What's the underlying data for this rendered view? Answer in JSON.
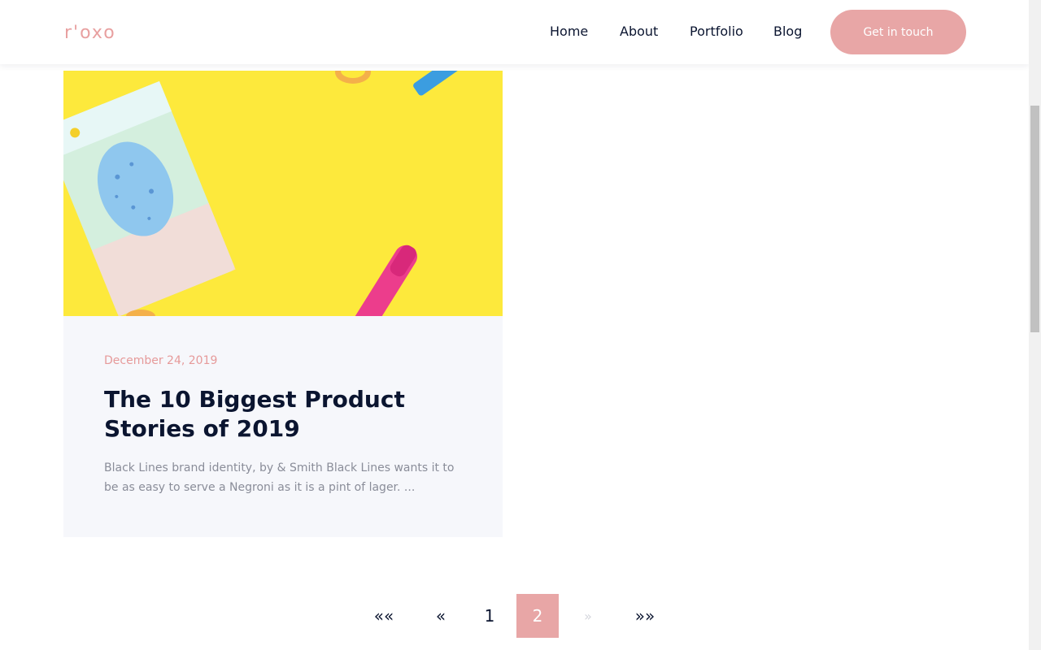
{
  "header": {
    "logo": "r'oxo",
    "nav": {
      "home": "Home",
      "about": "About",
      "portfolio": "Portfolio",
      "blog": "Blog"
    },
    "cta_label": "Get in touch"
  },
  "post": {
    "date": "December 24, 2019",
    "title": "The 10 Biggest Product Stories of 2019",
    "excerpt": "Black Lines brand identity, by & Smith Black Lines wants it to be as easy to serve a Negroni as it is a pint of lager. ..."
  },
  "pagination": {
    "first": "««",
    "prev": "«",
    "pages": [
      "1",
      "2"
    ],
    "current_page": "2",
    "next": "»",
    "last": "»»"
  },
  "colors": {
    "accent": "#e8a6a6",
    "heading": "#0b1530",
    "muted_text": "#8a8d99",
    "card_bg": "#f6f7fb",
    "image_bg": "#fde93c"
  }
}
